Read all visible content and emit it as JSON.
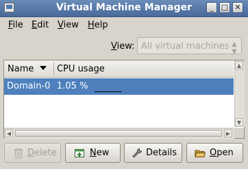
{
  "window": {
    "title": "Virtual Machine Manager",
    "controls": {
      "minimize": "_",
      "maximize": "□",
      "close": "✕"
    }
  },
  "menu": [
    {
      "mnemonic": "F",
      "rest": "ile"
    },
    {
      "mnemonic": "E",
      "rest": "dit"
    },
    {
      "mnemonic": "V",
      "rest": "iew"
    },
    {
      "mnemonic": "H",
      "rest": "elp"
    }
  ],
  "view_filter": {
    "label_mnemonic": "V",
    "label_rest": "iew:",
    "selected": "All virtual machines",
    "enabled": false
  },
  "table": {
    "columns": [
      "Name",
      "CPU usage"
    ],
    "sort_column": "Name",
    "rows": [
      {
        "name": "Domain-0",
        "cpu": "1.05 %",
        "selected": true
      }
    ]
  },
  "buttons": {
    "delete": {
      "mnemonic": "D",
      "rest": "elete",
      "enabled": false
    },
    "new": {
      "mnemonic": "N",
      "rest": "ew",
      "enabled": true
    },
    "details": {
      "label": "Details",
      "enabled": true
    },
    "open": {
      "mnemonic": "O",
      "rest": "pen",
      "enabled": true
    }
  },
  "icons": {
    "app": "virt-manager-icon",
    "sort": "sort-descending-icon",
    "delete": "trash-icon",
    "new": "new-vm-icon",
    "details": "wrench-icon",
    "open": "folder-icon"
  },
  "colors": {
    "titlebar": "#49699a",
    "selection": "#4e80bd",
    "window_bg": "#d7d4cc"
  }
}
